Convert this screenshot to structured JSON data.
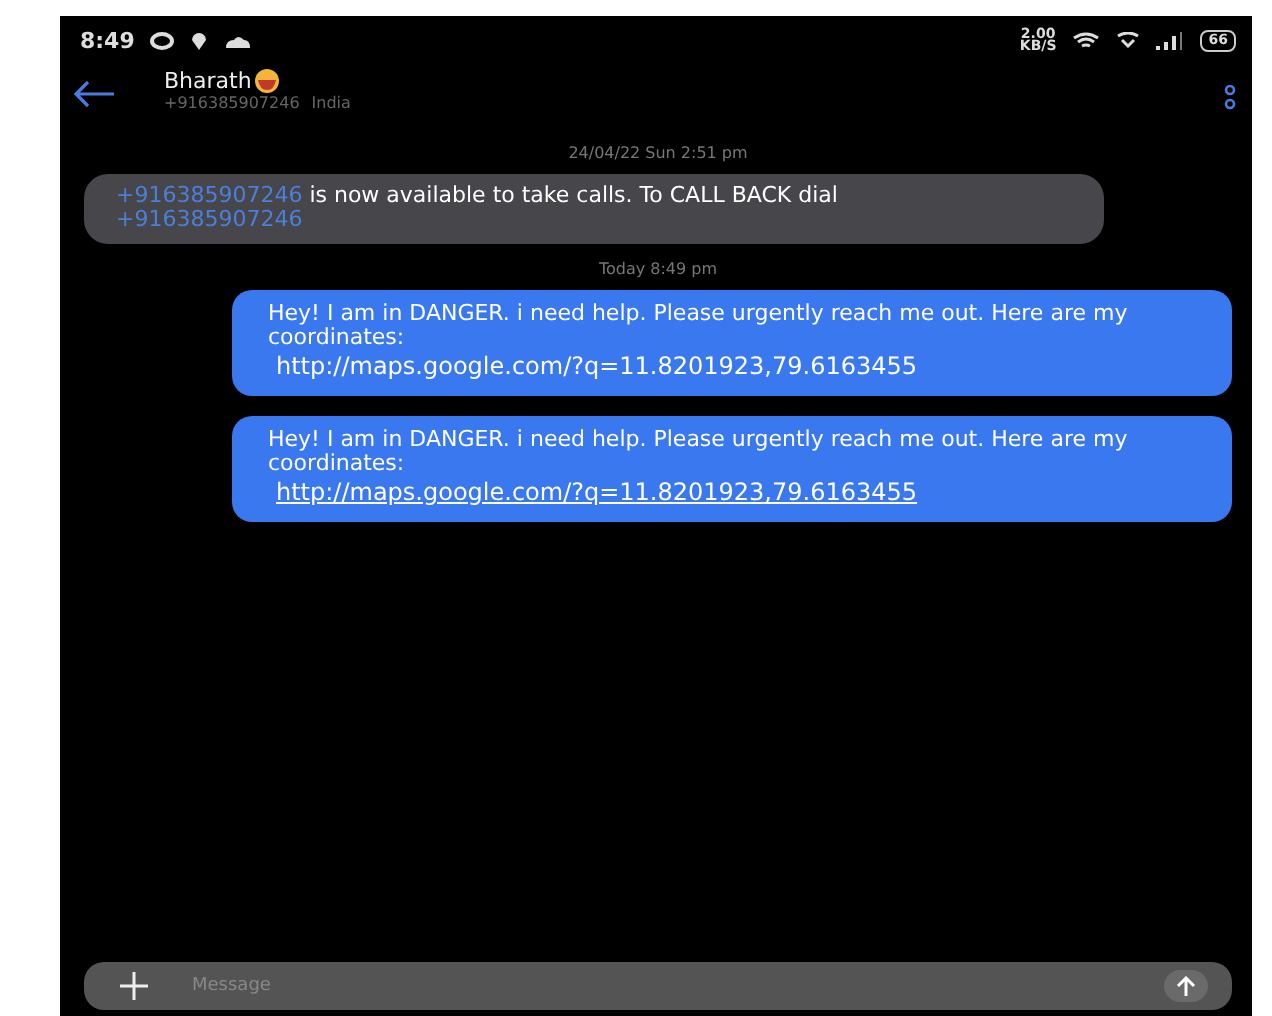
{
  "status_bar": {
    "time": "8:49",
    "speed": "2.00",
    "speed_unit": "KB/S",
    "battery": "66"
  },
  "header": {
    "name": "Bharath",
    "number": "+916385907246",
    "country": "India"
  },
  "messages": [
    {
      "kind": "timestamp",
      "text": "24/04/22 Sun 2:51 pm"
    },
    {
      "kind": "received",
      "parts": [
        {
          "kind": "link",
          "text": "+916385907246"
        },
        {
          "kind": "text",
          "text": " is now available to take calls. To CALL BACK dial "
        },
        {
          "kind": "link",
          "text": "+916385907246"
        }
      ]
    },
    {
      "kind": "timestamp",
      "text": "Today 8:49 pm"
    },
    {
      "kind": "sent",
      "text": "Hey! I am in DANGER. i need help. Please urgently reach me out. Here are my coordinates:",
      "link": "http://maps.google.com/?q=11.8201923,79.6163455",
      "link_underlined": false
    },
    {
      "kind": "sent",
      "text": "Hey! I am in DANGER. i need help. Please urgently reach me out. Here are my coordinates:",
      "link": "http://maps.google.com/?q=11.8201923,79.6163455",
      "link_underlined": true
    }
  ],
  "composer": {
    "placeholder": "Message"
  }
}
